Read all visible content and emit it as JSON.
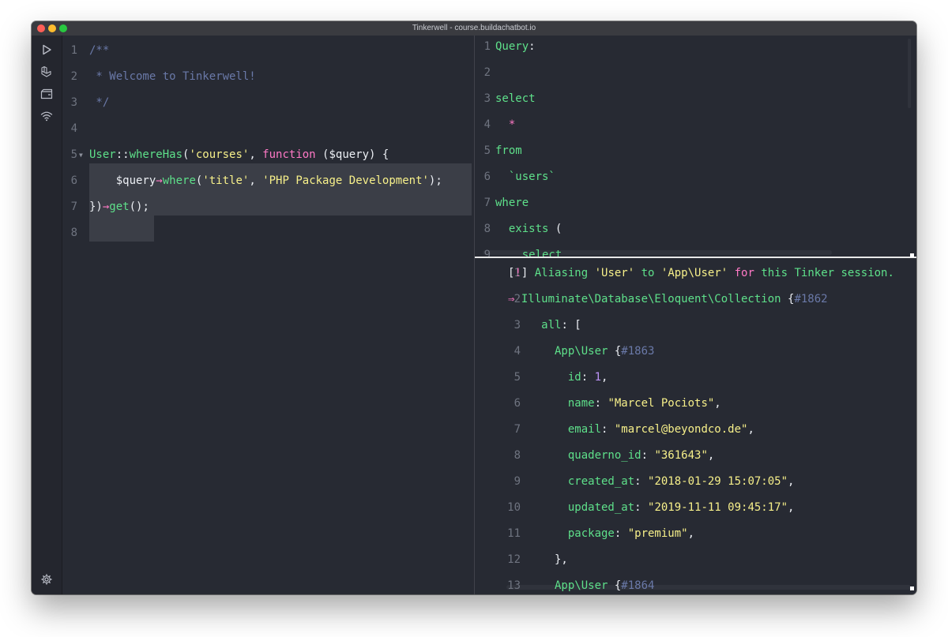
{
  "window": {
    "title": "Tinkerwell - course.buildachatbot.io"
  },
  "sidebar": {
    "icons": [
      "play-icon",
      "laravel-icon",
      "folder-icon",
      "wifi-icon"
    ],
    "footer_icon": "gear-icon"
  },
  "editor": {
    "lines": [
      {
        "n": "1",
        "tokens": [
          {
            "t": "/**",
            "c": "comment"
          }
        ]
      },
      {
        "n": "2",
        "tokens": [
          {
            "t": " * Welcome to Tinkerwell!",
            "c": "comment"
          }
        ]
      },
      {
        "n": "3",
        "tokens": [
          {
            "t": " */",
            "c": "comment"
          }
        ]
      },
      {
        "n": "4",
        "tokens": []
      },
      {
        "n": "5",
        "fold": true,
        "tokens": [
          {
            "t": "User",
            "c": "class"
          },
          {
            "t": "::",
            "c": "punc"
          },
          {
            "t": "whereHas",
            "c": "fn"
          },
          {
            "t": "(",
            "c": "punc"
          },
          {
            "t": "'courses'",
            "c": "str"
          },
          {
            "t": ", ",
            "c": "punc"
          },
          {
            "t": "function",
            "c": "kw"
          },
          {
            "t": " (",
            "c": "punc"
          },
          {
            "t": "$query",
            "c": "var"
          },
          {
            "t": ") {",
            "c": "punc"
          }
        ]
      },
      {
        "n": "6",
        "tokens": [
          {
            "t": "    $query",
            "c": "var"
          },
          {
            "t": "→",
            "c": "arrow"
          },
          {
            "t": "where",
            "c": "fn"
          },
          {
            "t": "(",
            "c": "punc"
          },
          {
            "t": "'title'",
            "c": "str"
          },
          {
            "t": ", ",
            "c": "punc"
          },
          {
            "t": "'PHP Package Development'",
            "c": "str"
          },
          {
            "t": ");",
            "c": "punc"
          }
        ]
      },
      {
        "n": "7",
        "tokens": [
          {
            "t": "})",
            "c": "punc"
          },
          {
            "t": "→",
            "c": "arrow"
          },
          {
            "t": "get",
            "c": "fn"
          },
          {
            "t": "();",
            "c": "punc"
          }
        ]
      },
      {
        "n": "8",
        "tokens": []
      }
    ]
  },
  "query_pane": {
    "lines": [
      {
        "n": "1",
        "tokens": [
          {
            "t": "Query",
            "c": "class"
          },
          {
            "t": ":",
            "c": "punc"
          }
        ]
      },
      {
        "n": "2",
        "tokens": []
      },
      {
        "n": "3",
        "tokens": [
          {
            "t": "select",
            "c": "class"
          }
        ]
      },
      {
        "n": "4",
        "tokens": [
          {
            "t": "  *",
            "c": "kw"
          }
        ]
      },
      {
        "n": "5",
        "tokens": [
          {
            "t": "from",
            "c": "class"
          }
        ]
      },
      {
        "n": "6",
        "tokens": [
          {
            "t": "  `users`",
            "c": "class"
          }
        ]
      },
      {
        "n": "7",
        "tokens": [
          {
            "t": "where",
            "c": "class"
          }
        ]
      },
      {
        "n": "8",
        "tokens": [
          {
            "t": "  exists",
            "c": "class"
          },
          {
            "t": " (",
            "c": "punc"
          }
        ]
      },
      {
        "n": "9",
        "tokens": [
          {
            "t": "    select",
            "c": "class"
          }
        ]
      }
    ]
  },
  "output_pane": {
    "lines": [
      {
        "n": "1",
        "tokens": [
          {
            "t": "[",
            "c": "punc"
          },
          {
            "t": "!",
            "c": "kw"
          },
          {
            "t": "] ",
            "c": "punc"
          },
          {
            "t": "Aliasing ",
            "c": "class"
          },
          {
            "t": "'User'",
            "c": "str"
          },
          {
            "t": " to ",
            "c": "class"
          },
          {
            "t": "'App\\User'",
            "c": "str"
          },
          {
            "t": " for ",
            "c": "kw"
          },
          {
            "t": "this Tinker session.",
            "c": "class"
          }
        ]
      },
      {
        "n": "2",
        "tokens": [
          {
            "t": "⇒ ",
            "c": "kw"
          },
          {
            "t": "Illuminate\\Database\\Eloquent\\Collection",
            "c": "class"
          },
          {
            "t": " {",
            "c": "punc"
          },
          {
            "t": "#1862",
            "c": "hash"
          }
        ]
      },
      {
        "n": "3",
        "tokens": [
          {
            "t": "     all",
            "c": "class"
          },
          {
            "t": ": [",
            "c": "punc"
          }
        ]
      },
      {
        "n": "4",
        "tokens": [
          {
            "t": "       App\\User",
            "c": "class"
          },
          {
            "t": " {",
            "c": "punc"
          },
          {
            "t": "#1863",
            "c": "hash"
          }
        ]
      },
      {
        "n": "5",
        "tokens": [
          {
            "t": "         id",
            "c": "class"
          },
          {
            "t": ": ",
            "c": "punc"
          },
          {
            "t": "1",
            "c": "num"
          },
          {
            "t": ",",
            "c": "punc"
          }
        ]
      },
      {
        "n": "6",
        "tokens": [
          {
            "t": "         name",
            "c": "class"
          },
          {
            "t": ": ",
            "c": "punc"
          },
          {
            "t": "\"Marcel Pociots\"",
            "c": "str"
          },
          {
            "t": ",",
            "c": "punc"
          }
        ]
      },
      {
        "n": "7",
        "tokens": [
          {
            "t": "         email",
            "c": "class"
          },
          {
            "t": ": ",
            "c": "punc"
          },
          {
            "t": "\"marcel@beyondco.de\"",
            "c": "str"
          },
          {
            "t": ",",
            "c": "punc"
          }
        ]
      },
      {
        "n": "8",
        "tokens": [
          {
            "t": "         quaderno_id",
            "c": "class"
          },
          {
            "t": ": ",
            "c": "punc"
          },
          {
            "t": "\"361643\"",
            "c": "str"
          },
          {
            "t": ",",
            "c": "punc"
          }
        ]
      },
      {
        "n": "9",
        "tokens": [
          {
            "t": "         created_at",
            "c": "class"
          },
          {
            "t": ": ",
            "c": "punc"
          },
          {
            "t": "\"2018-01-29 15:07:05\"",
            "c": "str"
          },
          {
            "t": ",",
            "c": "punc"
          }
        ]
      },
      {
        "n": "10",
        "tokens": [
          {
            "t": "         updated_at",
            "c": "class"
          },
          {
            "t": ": ",
            "c": "punc"
          },
          {
            "t": "\"2019-11-11 09:45:17\"",
            "c": "str"
          },
          {
            "t": ",",
            "c": "punc"
          }
        ]
      },
      {
        "n": "11",
        "tokens": [
          {
            "t": "         package",
            "c": "class"
          },
          {
            "t": ": ",
            "c": "punc"
          },
          {
            "t": "\"premium\"",
            "c": "str"
          },
          {
            "t": ",",
            "c": "punc"
          }
        ]
      },
      {
        "n": "12",
        "tokens": [
          {
            "t": "       },",
            "c": "punc"
          }
        ]
      },
      {
        "n": "13",
        "tokens": [
          {
            "t": "       App\\User",
            "c": "class"
          },
          {
            "t": " {",
            "c": "punc"
          },
          {
            "t": "#1864",
            "c": "hash"
          }
        ]
      }
    ]
  },
  "colors": {
    "background": "#272a33",
    "sidebar": "#24262e",
    "green": "#5ee08a",
    "yellow": "#f7f08a",
    "pink": "#ff79c6",
    "comment": "#6a79a8"
  }
}
